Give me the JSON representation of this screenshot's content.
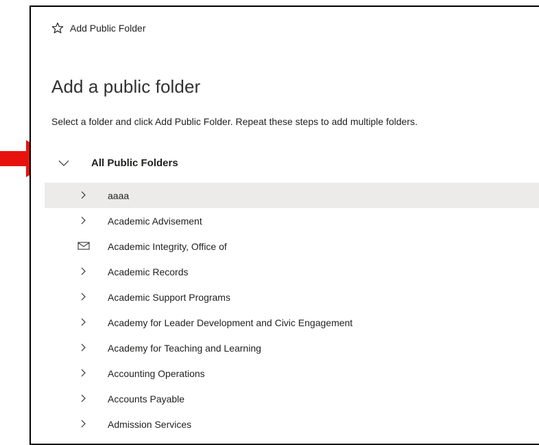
{
  "panel": {
    "header_title": "Add Public Folder",
    "page_title": "Add a public folder",
    "instructions": "Select a folder and click Add Public Folder. Repeat these steps to add multiple folders."
  },
  "tree": {
    "root": {
      "label": "All Public Folders",
      "expanded": true
    },
    "items": [
      {
        "label": "aaaa",
        "icon": "chevron-right-icon",
        "selected": true
      },
      {
        "label": "Academic Advisement",
        "icon": "chevron-right-icon"
      },
      {
        "label": "Academic Integrity, Office of",
        "icon": "mail-icon"
      },
      {
        "label": "Academic Records",
        "icon": "chevron-right-icon"
      },
      {
        "label": "Academic Support Programs",
        "icon": "chevron-right-icon"
      },
      {
        "label": "Academy for Leader Development and Civic Engagement",
        "icon": "chevron-right-icon"
      },
      {
        "label": "Academy for Teaching and Learning",
        "icon": "chevron-right-icon"
      },
      {
        "label": "Accounting Operations",
        "icon": "chevron-right-icon"
      },
      {
        "label": "Accounts Payable",
        "icon": "chevron-right-icon"
      },
      {
        "label": "Admission Services",
        "icon": "chevron-right-icon"
      }
    ]
  },
  "colors": {
    "annotation_arrow": "#e8120c",
    "selected_row": "#edebe9",
    "text": "#201f1e"
  }
}
